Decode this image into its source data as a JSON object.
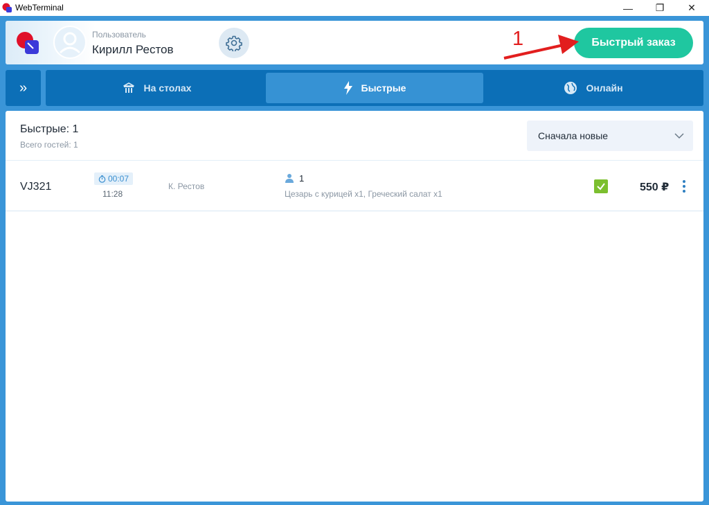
{
  "window": {
    "title": "WebTerminal",
    "minimize_glyph": "—",
    "maximize_glyph": "❐",
    "close_glyph": "✕"
  },
  "header": {
    "user_caption": "Пользователь",
    "user_name": "Кирилл Рестов",
    "quick_order_label": "Быстрый заказ",
    "annotation_number": "1"
  },
  "tabs": {
    "expand_glyph": "»",
    "items": [
      {
        "label": "На столах",
        "icon": "tables-icon"
      },
      {
        "label": "Быстрые",
        "icon": "lightning-icon",
        "active": true
      },
      {
        "label": "Онлайн",
        "icon": "globe-icon"
      }
    ]
  },
  "list": {
    "title": "Быстрые: 1",
    "subtitle": "Всего гостей: 1",
    "sort_value": "Сначала новые"
  },
  "orders": [
    {
      "id": "VJ321",
      "timer": "00:07",
      "time": "11:28",
      "waiter": "К. Рестов",
      "guests": "1",
      "items": "Цезарь с курицей x1, Греческий салат x1",
      "price": "550 ₽",
      "status": "paid"
    }
  ],
  "colors": {
    "accent_blue": "#0c6fb7",
    "window_bg": "#3a95d8",
    "active_tab": "#3692d4",
    "quick_button": "#1fc7a0",
    "check_green": "#7cbf2f",
    "annotation_red": "#e21e1e"
  }
}
